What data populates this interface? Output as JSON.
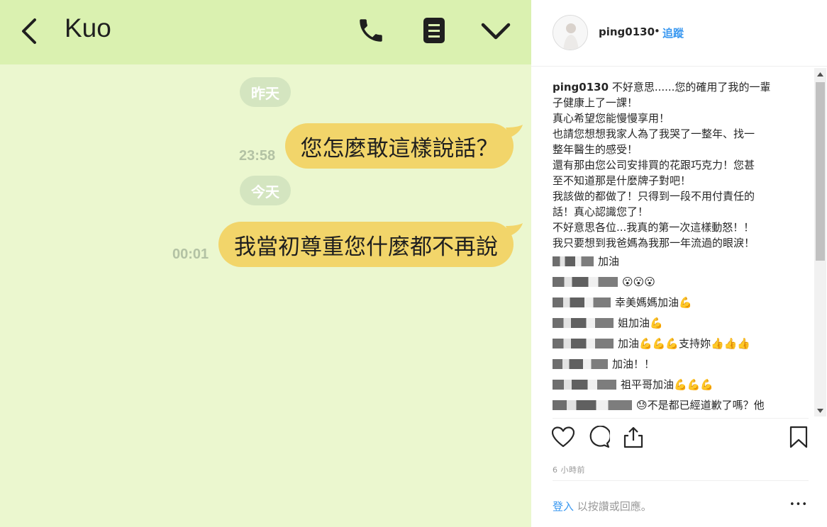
{
  "chat": {
    "title": "Kuo",
    "messages": [
      {
        "date": "昨天",
        "time": "23:58",
        "text": "您怎麼敢這樣說話？"
      },
      {
        "date": "今天",
        "time": "00:01",
        "text": "我當初尊重您什麼都不再說"
      }
    ]
  },
  "post": {
    "username": "ping0130",
    "separator": "•",
    "follow_label": "追蹤",
    "caption_user": "ping0130",
    "caption_lines": [
      "不好意思......您的確用了我的一輩",
      "子健康上了一課！",
      "真心希望您能慢慢享用！",
      "也請您想想我家人為了我哭了一整年、找一",
      "整年醫生的感受！",
      "還有那由您公司安排買的花跟巧克力！您甚",
      "至不知道那是什麼牌子對吧！",
      "我該做的都做了！只得到一段不用付責任的",
      "話！真心認識您了！",
      "不好意思各位...我真的第一次這樣動怒！！",
      "我只要想到我爸媽為我那一年流過的眼淚！"
    ],
    "comments": [
      {
        "text": "加油",
        "emoji": ""
      },
      {
        "text": "",
        "emoji": "😮😮😮"
      },
      {
        "text": "幸美媽媽加油",
        "emoji": "💪"
      },
      {
        "text": "姐加油",
        "emoji": "💪"
      },
      {
        "text": "加油",
        "emoji": "💪💪💪",
        "extra": " 支持妳",
        "extra_emoji": "👍👍👍"
      },
      {
        "text": "加油！！",
        "emoji": ""
      },
      {
        "text": "祖平哥加油",
        "emoji": "💪💪💪"
      },
      {
        "text": "不是都已經道歉了嗎？他",
        "emoji": "😓",
        "emoji_first": true
      }
    ],
    "time_ago": "6 小時前",
    "login_link": "登入",
    "login_rest": " 以按讚或回應。",
    "more_label": "•••"
  },
  "colors": {
    "chat_bg": "#ebf7cf",
    "chat_header": "#daf1b0",
    "bubble": "#f2d56a",
    "link": "#3897f0"
  },
  "icons": [
    "back-arrow-icon",
    "phone-icon",
    "notes-icon",
    "chevron-down-icon",
    "heart-icon",
    "comment-icon",
    "share-icon",
    "bookmark-icon"
  ]
}
